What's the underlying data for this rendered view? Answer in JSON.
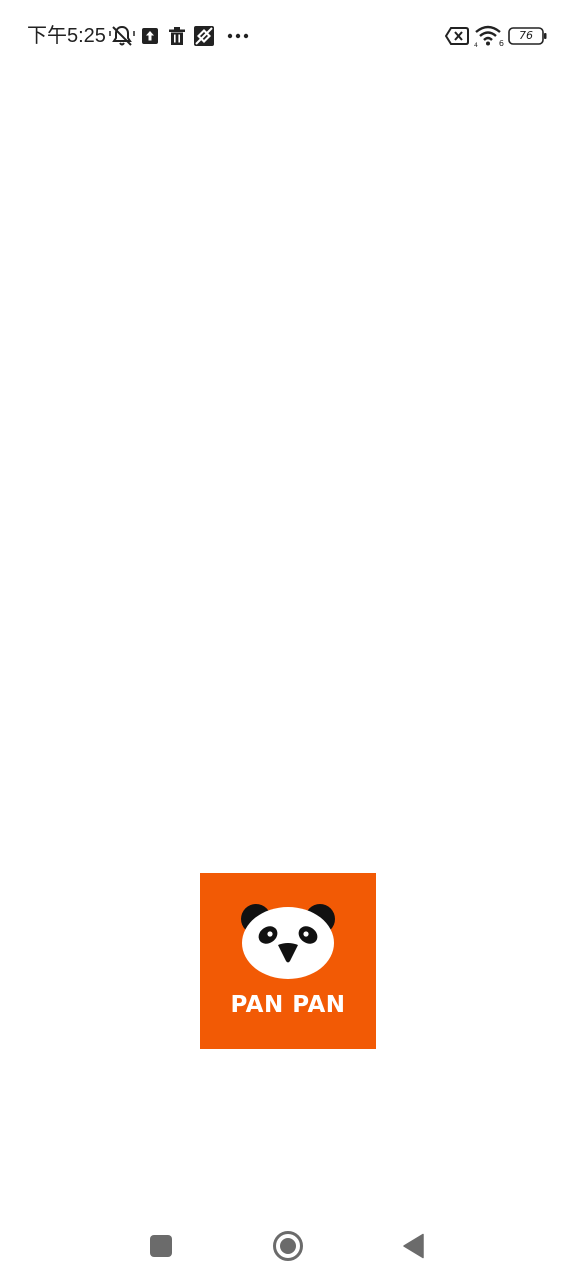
{
  "status_bar": {
    "time": "下午5:25",
    "battery_level": "76",
    "wifi_label": "6",
    "icons": [
      "mute-bell-icon",
      "upload-icon",
      "trash-icon",
      "diamond-icon",
      "more-icon",
      "sim-off-icon",
      "wifi-icon",
      "battery-icon"
    ]
  },
  "splash": {
    "brand_name": "PAN PAN",
    "brand_color": "#f25a05"
  },
  "nav_bar": {
    "icons": [
      "recent-apps-icon",
      "home-icon",
      "back-icon"
    ]
  }
}
